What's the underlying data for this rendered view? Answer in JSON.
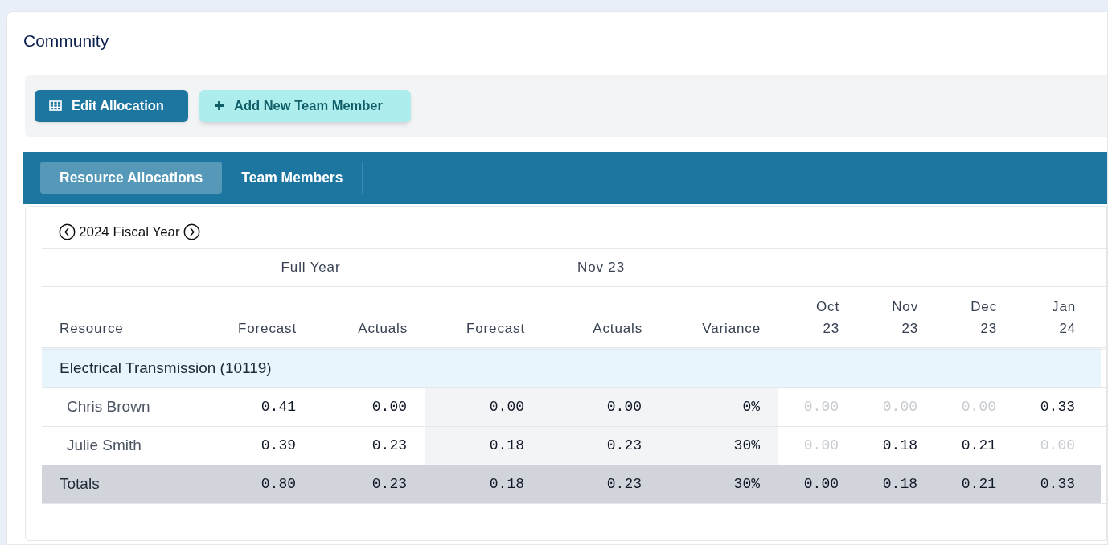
{
  "title": "Community",
  "toolbar": {
    "buttons": [
      {
        "label": "Edit Allocation",
        "kind": "primary"
      },
      {
        "label": "Add New Team Member",
        "kind": "secondary"
      }
    ]
  },
  "tabs": [
    {
      "label": "Resource Allocations",
      "selected": true
    },
    {
      "label": "Team Members",
      "selected": false
    }
  ],
  "period": {
    "label": "2024 Fiscal Year"
  },
  "table": {
    "column_groups": [
      {
        "label": "Full Year"
      },
      {
        "label": "Nov 23"
      }
    ],
    "columns": [
      "Resource",
      "Forecast",
      "Actuals",
      "Forecast",
      "Actuals",
      "Variance",
      "Oct 23",
      "Nov 23",
      "Dec 23",
      "Jan 24"
    ],
    "groups": [
      {
        "name": "Electrical Transmission (10119)",
        "rows": [
          {
            "name": "Chris Brown",
            "cells": [
              {
                "value": "0.41",
                "dimmed": false
              },
              {
                "value": "0.00",
                "dimmed": false
              },
              {
                "value": "0.00",
                "dimmed": false
              },
              {
                "value": "0.00",
                "dimmed": false
              },
              {
                "value": "0%",
                "dimmed": false
              },
              {
                "value": "0.00",
                "dimmed": true
              },
              {
                "value": "0.00",
                "dimmed": true
              },
              {
                "value": "0.00",
                "dimmed": true
              },
              {
                "value": "0.33",
                "dimmed": false
              }
            ]
          },
          {
            "name": "Julie Smith",
            "cells": [
              {
                "value": "0.39",
                "dimmed": false
              },
              {
                "value": "0.23",
                "dimmed": false
              },
              {
                "value": "0.18",
                "dimmed": false
              },
              {
                "value": "0.23",
                "dimmed": false
              },
              {
                "value": "30%",
                "dimmed": false
              },
              {
                "value": "0.00",
                "dimmed": true
              },
              {
                "value": "0.18",
                "dimmed": false
              },
              {
                "value": "0.21",
                "dimmed": false
              },
              {
                "value": "0.00",
                "dimmed": true
              }
            ]
          }
        ]
      }
    ],
    "totals": {
      "label": "Totals",
      "cells": [
        {
          "value": "0.80",
          "dimmed": false
        },
        {
          "value": "0.23",
          "dimmed": false
        },
        {
          "value": "0.18",
          "dimmed": false
        },
        {
          "value": "0.23",
          "dimmed": false
        },
        {
          "value": "30%",
          "dimmed": false
        },
        {
          "value": "0.00",
          "dimmed": false
        },
        {
          "value": "0.18",
          "dimmed": false
        },
        {
          "value": "0.21",
          "dimmed": false
        },
        {
          "value": "0.33",
          "dimmed": false
        }
      ]
    }
  }
}
